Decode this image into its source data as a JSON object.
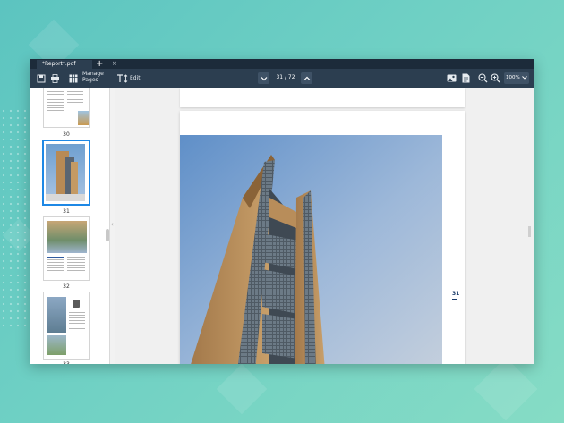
{
  "tab": {
    "title": "*Report*.pdf",
    "close": "×",
    "add": "+"
  },
  "toolbar": {
    "manage_pages_line1": "Manage",
    "manage_pages_line2": "Pages",
    "edit_label": "Edit",
    "page_indicator": "31 / 72",
    "zoom_value": "100%"
  },
  "thumbnails": [
    {
      "label": "30"
    },
    {
      "label": "31",
      "selected": true
    },
    {
      "label": "32"
    },
    {
      "label": "33"
    }
  ],
  "page": {
    "number": "31"
  },
  "colors": {
    "tabbar": "#1c2b3a",
    "toolbar": "#2c3e50",
    "selection": "#1e88e5",
    "background": "#6fd0c4"
  },
  "icons": [
    "save-icon",
    "print-icon",
    "grid-icon",
    "text-edit-icon",
    "chevron-down-icon",
    "chevron-up-icon",
    "image-icon",
    "document-icon",
    "zoom-out-icon",
    "zoom-in-icon"
  ]
}
